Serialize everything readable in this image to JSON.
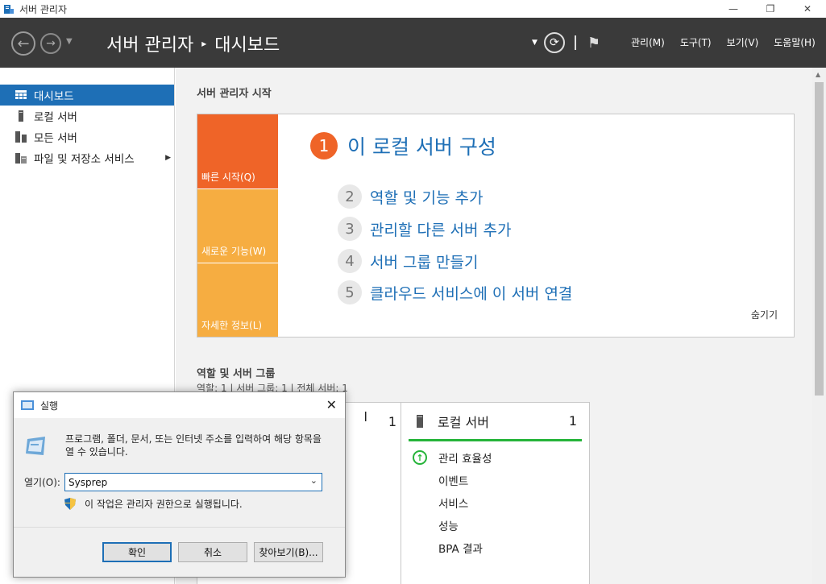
{
  "window": {
    "title": "서버 관리자",
    "minimize_glyph": "—",
    "restore_glyph": "❐",
    "close_glyph": "✕"
  },
  "header": {
    "breadcrumb_root": "서버 관리자",
    "breadcrumb_sep": "▸",
    "breadcrumb_current": "대시보드",
    "menus": [
      "관리(M)",
      "도구(T)",
      "보기(V)",
      "도움말(H)"
    ]
  },
  "leftnav": {
    "items": [
      {
        "label": "대시보드",
        "icon": "dashboard-icon",
        "active": true
      },
      {
        "label": "로컬 서버",
        "icon": "server-icon"
      },
      {
        "label": "모든 서버",
        "icon": "servers-icon"
      },
      {
        "label": "파일 및 저장소 서비스",
        "icon": "file-storage-icon"
      }
    ]
  },
  "welcome": {
    "title": "서버 관리자 시작",
    "tabs": [
      "빠른 시작(Q)",
      "새로운 기능(W)",
      "자세한 정보(L)"
    ],
    "step1": {
      "num": "1",
      "label": "이 로컬 서버 구성"
    },
    "steps": [
      {
        "num": "2",
        "label": "역할 및 기능 추가"
      },
      {
        "num": "3",
        "label": "관리할 다른 서버 추가"
      },
      {
        "num": "4",
        "label": "서버 그룹 만들기"
      },
      {
        "num": "5",
        "label": "클라우드 서비스에 이 서버 연결"
      }
    ],
    "hide": "숨기기"
  },
  "roles": {
    "title": "역할 및 서버 그룹",
    "subtitle": "역할: 1  |  서버 그룹: 1  |  전체 서버: 1",
    "tile_a": {
      "name_fragment": "l",
      "count": "1"
    },
    "tile_b": {
      "name": "로컬 서버",
      "count": "1",
      "rows": [
        "관리 효율성",
        "이벤트",
        "서비스",
        "성능",
        "BPA 결과"
      ]
    }
  },
  "run_dialog": {
    "title": "실행",
    "description": "프로그램, 폴더, 문서, 또는 인터넷 주소를 입력하여 해당 항목을 열 수 있습니다.",
    "open_label": "열기(O):",
    "input_value": "Sysprep",
    "admin_note": "이 작업은 관리자 권한으로 실행됩니다.",
    "ok": "확인",
    "cancel": "취소",
    "browse": "찾아보기(B)..."
  },
  "colors": {
    "header_bg": "#3a3a3a",
    "accent_blue": "#1e6fb6",
    "quickstart_orange": "#ef6428",
    "tab_yellow": "#f6ad41",
    "status_green": "#26b43a"
  }
}
